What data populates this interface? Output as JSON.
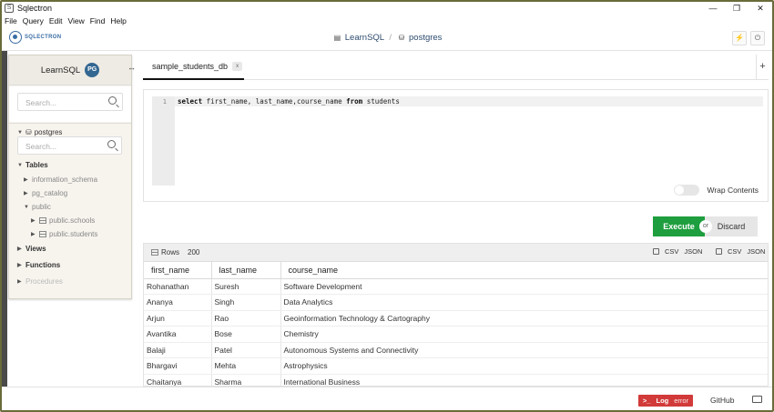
{
  "window": {
    "title": "Sqlectron",
    "controls": [
      "—",
      "❐",
      "✕"
    ]
  },
  "menu": [
    "File",
    "Query",
    "Edit",
    "View",
    "Find",
    "Help"
  ],
  "header": {
    "logo_text": "SQLECTRON",
    "connection": "LearnSQL",
    "database": "postgres"
  },
  "sidebar": {
    "title": "LearnSQL",
    "search_placeholder": "Search...",
    "db_name": "postgres",
    "db_search_placeholder": "Search...",
    "tables_label": "Tables",
    "schemas": [
      "information_schema",
      "pg_catalog",
      "public"
    ],
    "tables": [
      "public.schools",
      "public.students"
    ],
    "views_label": "Views",
    "functions_label": "Functions",
    "procedures_label": "Procedures"
  },
  "tabs": [
    {
      "label": "sample_students_db",
      "close": "x"
    }
  ],
  "add_tab_label": "+",
  "editor": {
    "line_number": "1",
    "code_keywords": [
      "select",
      "from"
    ],
    "code_cols": " first_name, last_name,course_name ",
    "code_table": " students",
    "wrap_label": "Wrap Contents"
  },
  "actions": {
    "execute": "Execute",
    "or": "or",
    "discard": "Discard"
  },
  "results": {
    "rows_label": "Rows",
    "rows_count": "200",
    "csv": "CSV",
    "json": "JSON",
    "columns": [
      "first_name",
      "last_name",
      "course_name"
    ],
    "rows": [
      [
        "Rohanathan",
        "Suresh",
        "Software Development"
      ],
      [
        "Ananya",
        "Singh",
        "Data Analytics"
      ],
      [
        "Arjun",
        "Rao",
        "Geoinformation Technology & Cartography"
      ],
      [
        "Avantika",
        "Bose",
        "Chemistry"
      ],
      [
        "Balaji",
        "Patel",
        "Autonomous Systems and Connectivity"
      ],
      [
        "Bhargavi",
        "Mehta",
        "Astrophysics"
      ],
      [
        "Chaitanya",
        "Sharma",
        "International Business"
      ]
    ]
  },
  "footer": {
    "log_label": "Log",
    "error_label": "error",
    "github": "GitHub"
  },
  "colors": {
    "execute_green": "#1e9e3e",
    "log_red": "#d23a3a",
    "accent_blue": "#3b6ea5"
  }
}
